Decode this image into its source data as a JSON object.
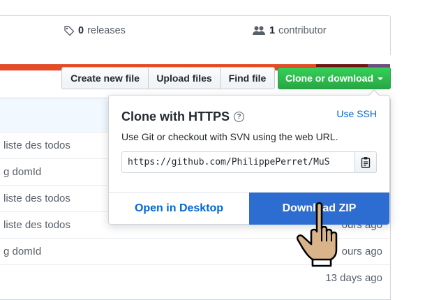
{
  "summary": {
    "releases_count": "0",
    "releases_label": "releases",
    "contributors_count": "1",
    "contributors_label": "contributor",
    "language_colors": [
      "#e34c26",
      "#701516",
      "#6e4c7e"
    ]
  },
  "toolbar": {
    "create_new_file": "Create new file",
    "upload_files": "Upload files",
    "find_file": "Find file",
    "clone_or_download": "Clone or download"
  },
  "files": {
    "rows": [
      {
        "message": "liste des todos",
        "age": ""
      },
      {
        "message": "g domId",
        "age": ""
      },
      {
        "message": "liste des todos",
        "age": ""
      },
      {
        "message": "liste des todos",
        "age": "ours ago"
      },
      {
        "message": "g domId",
        "age": "ours ago"
      },
      {
        "message": "",
        "age": "13 days ago"
      }
    ]
  },
  "clone_panel": {
    "title": "Clone with HTTPS",
    "help_icon": "question-icon",
    "use_ssh": "Use SSH",
    "description": "Use Git or checkout with SVN using the web URL.",
    "url": "https://github.com/PhilippePerret/MuS",
    "open_desktop": "Open in Desktop",
    "download_zip": "Download ZIP"
  },
  "colors": {
    "accent_blue": "#0366d6",
    "download_bg": "#2d6dd2",
    "clone_green": "#28a745"
  }
}
